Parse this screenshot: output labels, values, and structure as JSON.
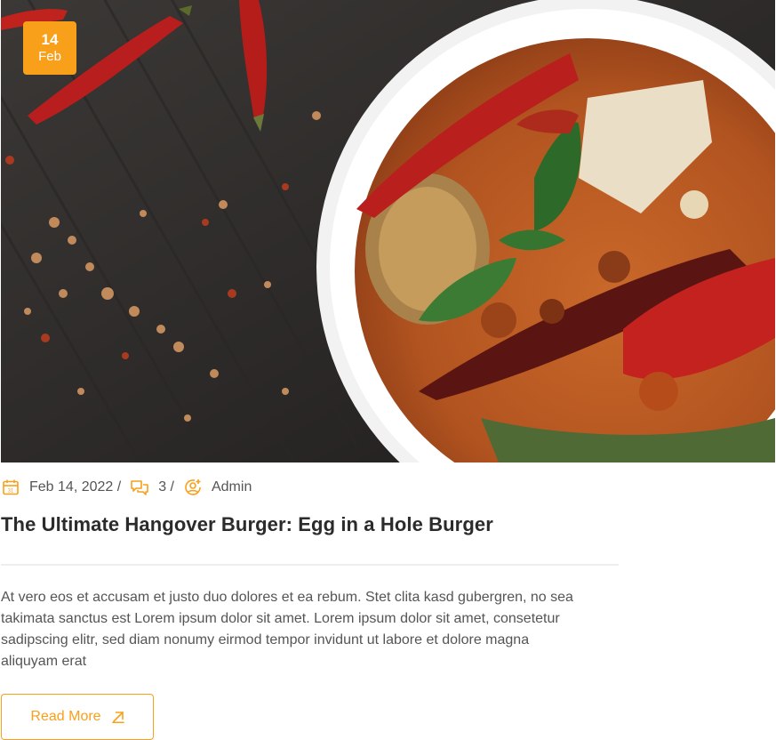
{
  "post": {
    "date_badge": {
      "day": "14",
      "month": "Feb"
    },
    "meta": {
      "date": "Feb 14, 2022 /",
      "comments": "3 /",
      "author": "Admin"
    },
    "title": "The Ultimate Hangover Burger: Egg in a Hole Burger",
    "excerpt": "At vero eos et accusam et justo duo dolores et ea rebum. Stet clita kasd gubergren, no sea takimata sanctus est Lorem ipsum dolor sit amet. Lorem ipsum dolor sit amet, consetetur sadipscing elitr, sed diam nonumy eirmod tempor invidunt ut labore et dolore magna aliquyam erat",
    "read_more_label": "Read More"
  },
  "icons": {
    "date": "calendar-icon",
    "comments": "chat-bubbles-icon",
    "author": "user-add-icon",
    "read_more": "arrow-up-right-icon"
  },
  "colors": {
    "accent": "#f9a01b",
    "text": "#555555",
    "title": "#2b2b2b"
  }
}
